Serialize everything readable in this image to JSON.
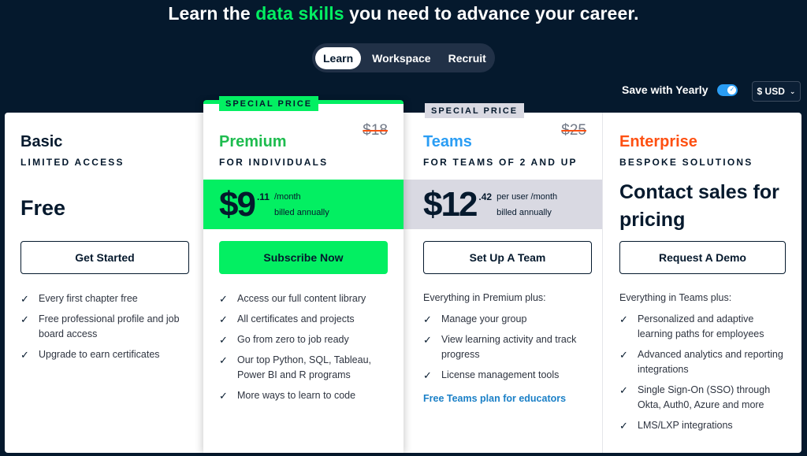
{
  "headline": {
    "before": "Learn the ",
    "accent": "data skills",
    "after": " you need to advance your career."
  },
  "tabs": [
    {
      "label": "Learn",
      "active": true
    },
    {
      "label": "Workspace",
      "active": false
    },
    {
      "label": "Recruit",
      "active": false
    }
  ],
  "billing": {
    "toggle_label": "Save with Yearly",
    "toggle_on": true,
    "currency": "$ USD"
  },
  "colors": {
    "background": "#05192d",
    "accent_green": "#03ef62",
    "teams_blue": "#2a9df4",
    "enterprise_orange": "#fe5012",
    "premium_name": "#1ebc4f"
  },
  "plans": {
    "basic": {
      "name": "Basic",
      "subtitle": "LIMITED ACCESS",
      "price": "Free",
      "cta": "Get Started",
      "features": [
        "Every first chapter free",
        "Free professional profile and job board access",
        "Upgrade to earn certificates"
      ]
    },
    "premium": {
      "badge": "SPECIAL PRICE",
      "name": "Premium",
      "subtitle": "FOR INDIVIDUALS",
      "old_price": "$18",
      "price_main": "$9",
      "price_cents": ".11",
      "price_unit": "/month",
      "billing_note": "billed annually",
      "cta": "Subscribe Now",
      "features": [
        "Access our full content library",
        "All certificates and projects",
        "Go from zero to job ready",
        "Our top Python, SQL, Tableau, Power BI and R programs",
        "More ways to learn to code"
      ]
    },
    "teams": {
      "badge": "SPECIAL PRICE",
      "name": "Teams",
      "subtitle": "FOR TEAMS OF 2 AND UP",
      "old_price": "$25",
      "price_main": "$12",
      "price_cents": ".42",
      "price_unit": "per user /month",
      "billing_note": "billed annually",
      "cta": "Set Up A Team",
      "intro": "Everything in Premium plus:",
      "features": [
        "Manage your group",
        "View learning activity and track progress",
        "License management tools"
      ],
      "link": "Free Teams plan for educators"
    },
    "enterprise": {
      "name": "Enterprise",
      "subtitle": "BESPOKE SOLUTIONS",
      "price": "Contact sales for pricing",
      "cta": "Request A Demo",
      "intro": "Everything in Teams plus:",
      "features": [
        "Personalized and adaptive learning paths for employees",
        "Advanced analytics and reporting integrations",
        "Single Sign-On (SSO) through Okta, Auth0, Azure and more",
        "LMS/LXP integrations"
      ]
    }
  },
  "icons": {
    "check": "✓",
    "toggle_check": "✓",
    "chevron": "⌄"
  }
}
